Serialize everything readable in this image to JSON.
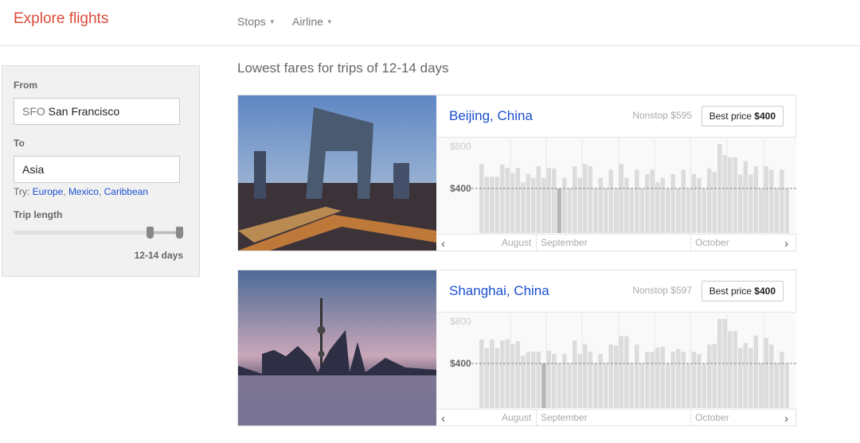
{
  "header": {
    "title": "Explore flights",
    "filters": [
      {
        "label": "Stops"
      },
      {
        "label": "Airline"
      }
    ]
  },
  "sidebar": {
    "from_label": "From",
    "from_code": "SFO",
    "from_city": "San Francisco",
    "to_label": "To",
    "to_value": "Asia",
    "try_label": "Try:",
    "suggestions": [
      "Europe",
      "Mexico",
      "Caribbean"
    ],
    "trip_label": "Trip length",
    "trip_value": "12-14 days"
  },
  "main": {
    "title": "Lowest fares for trips of 12-14 days"
  },
  "colors": {
    "accent": "#dd4b39",
    "link": "#1a4fd0",
    "bar": "#dcdcdc",
    "bar_selected": "#b5b5b5"
  },
  "chart_data": [
    {
      "type": "bar",
      "destination": "Beijing, China",
      "nonstop": "Nonstop $595",
      "best_label": "Best price",
      "best_value": "$400",
      "y_ticks": [
        "$800",
        "$400"
      ],
      "ylim": [
        0,
        800
      ],
      "reference_line": 400,
      "x_labels": [
        "August",
        "September",
        "October"
      ],
      "selected_index": 15,
      "values": [
        620,
        505,
        505,
        505,
        615,
        585,
        540,
        585,
        455,
        530,
        495,
        600,
        495,
        585,
        580,
        400,
        495,
        400,
        600,
        495,
        620,
        600,
        400,
        495,
        400,
        570,
        400,
        620,
        495,
        400,
        570,
        400,
        530,
        570,
        455,
        495,
        400,
        530,
        400,
        570,
        400,
        530,
        495,
        400,
        580,
        550,
        800,
        700,
        680,
        680,
        525,
        645,
        525,
        600,
        400,
        600,
        570,
        400,
        570,
        400
      ]
    },
    {
      "type": "bar",
      "destination": "Shanghai, China",
      "nonstop": "Nonstop $597",
      "best_label": "Best price",
      "best_value": "$400",
      "y_ticks": [
        "$800",
        "$400"
      ],
      "ylim": [
        0,
        800
      ],
      "reference_line": 400,
      "x_labels": [
        "August",
        "September",
        "October"
      ],
      "selected_index": 12,
      "values": [
        615,
        540,
        615,
        540,
        605,
        615,
        575,
        600,
        470,
        505,
        505,
        505,
        400,
        515,
        485,
        400,
        485,
        400,
        605,
        485,
        575,
        505,
        400,
        485,
        400,
        570,
        560,
        645,
        645,
        400,
        570,
        400,
        505,
        505,
        540,
        550,
        400,
        505,
        530,
        505,
        400,
        505,
        485,
        400,
        570,
        575,
        800,
        800,
        690,
        690,
        540,
        585,
        540,
        650,
        400,
        630,
        570,
        400,
        505,
        400
      ]
    }
  ]
}
